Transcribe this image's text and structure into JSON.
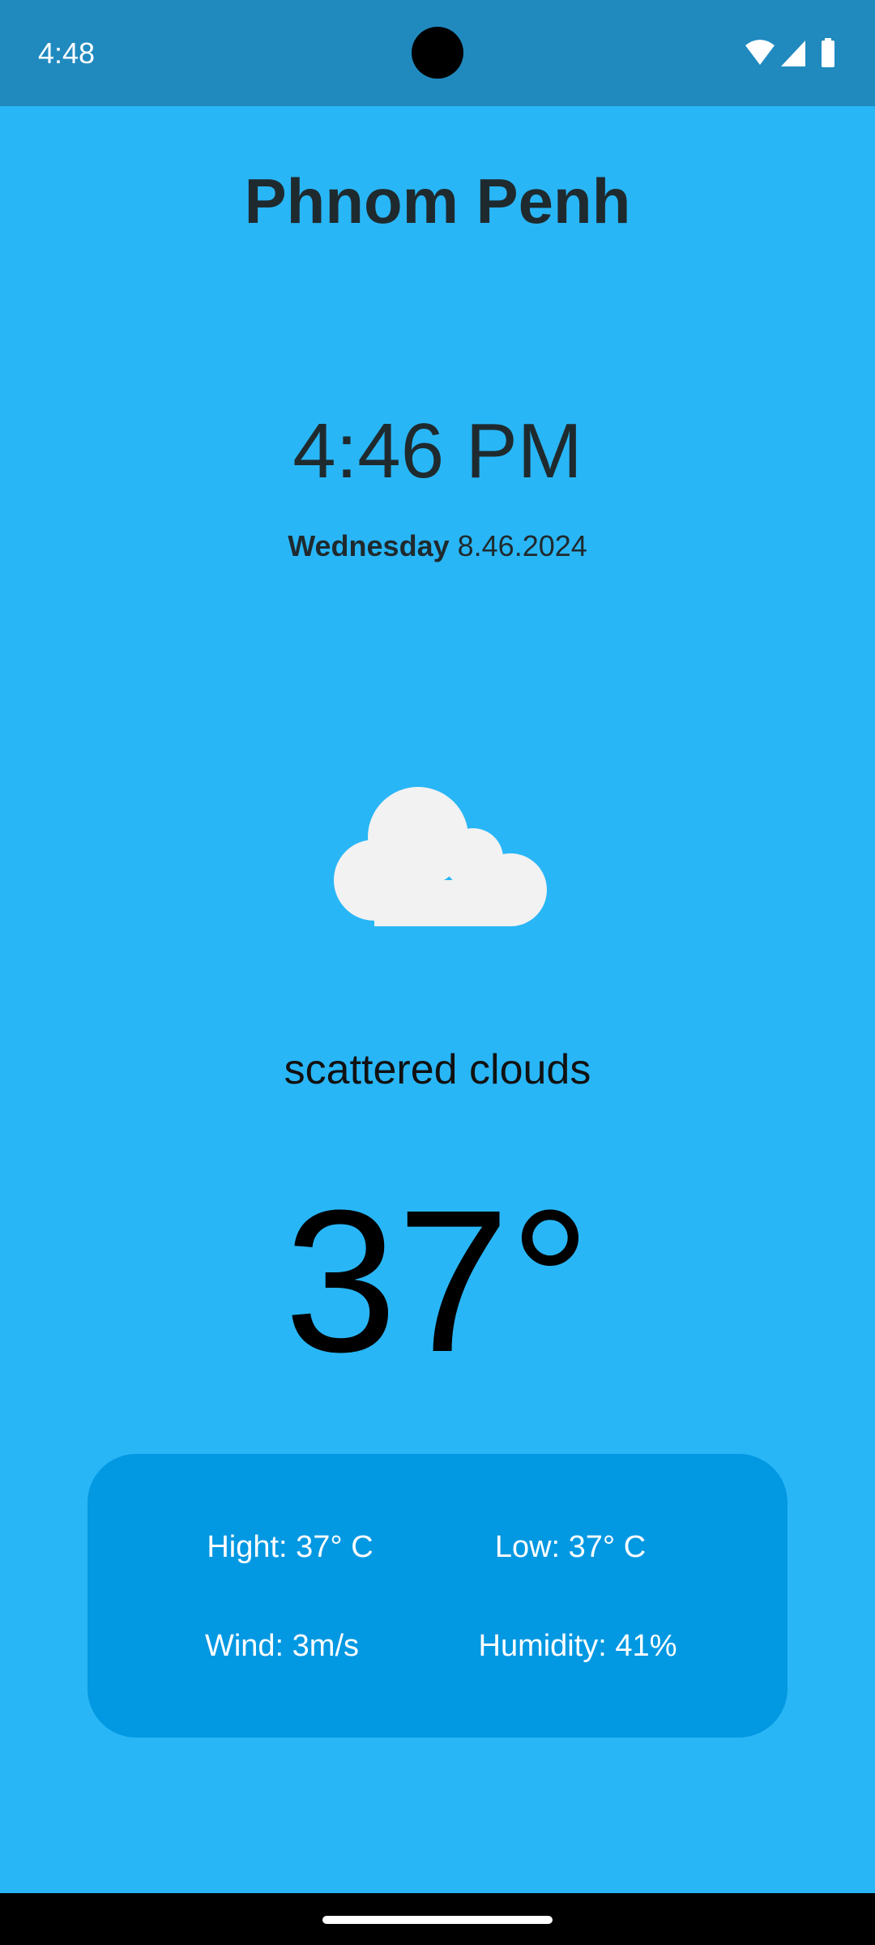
{
  "status_bar": {
    "time": "4:48",
    "icons": [
      "wifi-icon",
      "cellular-signal-icon",
      "battery-icon"
    ]
  },
  "weather": {
    "city": "Phnom Penh",
    "time": "4:46 PM",
    "day": "Wednesday",
    "date": "8.46.2024",
    "icon": "cloud-icon",
    "description": "scattered clouds",
    "temperature": "37°"
  },
  "details": {
    "high": "Hight: 37° C",
    "low": "Low: 37° C",
    "wind": "Wind: 3m/s",
    "humidity": "Humidity: 41%"
  },
  "colors": {
    "background": "#29b6f6",
    "status_bar": "#208abf",
    "card": "#0398e2",
    "cloud": "#f2f2f2"
  }
}
